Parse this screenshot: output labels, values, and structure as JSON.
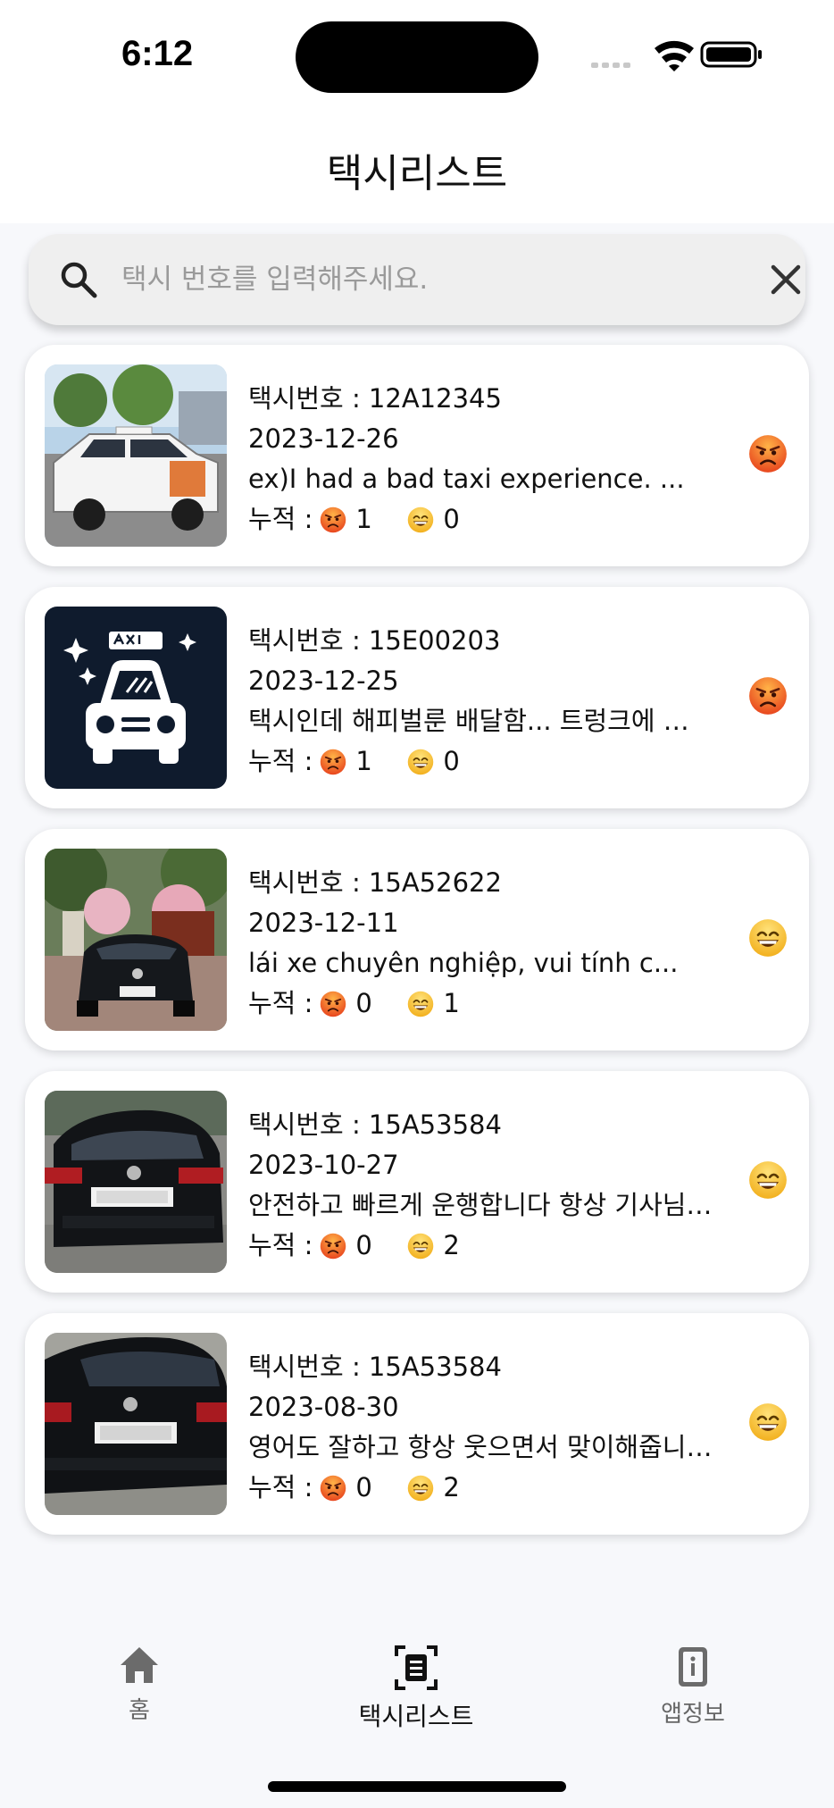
{
  "status_bar": {
    "time": "6:12"
  },
  "header": {
    "title": "택시리스트"
  },
  "search": {
    "placeholder": "택시 번호를 입력해주세요.",
    "value": ""
  },
  "labels": {
    "cumulative": "누적 :"
  },
  "cards": [
    {
      "plate": "택시번호 : 12A12345",
      "date": "2023-12-26",
      "review": "ex)I had a bad taxi experience. ...",
      "angry": "1",
      "happy": "0",
      "mood": "angry",
      "thumb": "white-taxi-photo"
    },
    {
      "plate": "택시번호 : 15E00203",
      "date": "2023-12-25",
      "review": "택시인데 해피벌룬 배달함... 트렁크에 …",
      "angry": "1",
      "happy": "0",
      "mood": "angry",
      "thumb": "taxi-logo"
    },
    {
      "plate": "택시번호 : 15A52622",
      "date": "2023-12-11",
      "review": "lái xe chuyên nghiệp, vui tính c...",
      "angry": "0",
      "happy": "1",
      "mood": "happy",
      "thumb": "black-sedan-front-photo"
    },
    {
      "plate": "택시번호 : 15A53584",
      "date": "2023-10-27",
      "review": "안전하고 빠르게 운행합니다 항상 기사님…",
      "angry": "0",
      "happy": "2",
      "mood": "happy",
      "thumb": "black-sedan-rear-photo"
    },
    {
      "plate": "택시번호 : 15A53584",
      "date": "2023-08-30",
      "review": "영어도 잘하고 항상 웃으면서 맞이해줍니다…",
      "angry": "0",
      "happy": "2",
      "mood": "happy",
      "thumb": "black-sedan-rear-photo"
    }
  ],
  "tabs": [
    {
      "label": "홈",
      "icon": "home-icon"
    },
    {
      "label": "택시리스트",
      "icon": "list-scan-icon",
      "active": true
    },
    {
      "label": "앱정보",
      "icon": "info-phone-icon"
    }
  ],
  "colors": {
    "angry": "#f05a28",
    "happy": "#f7c531",
    "logo_bg": "#0f1b2d"
  }
}
